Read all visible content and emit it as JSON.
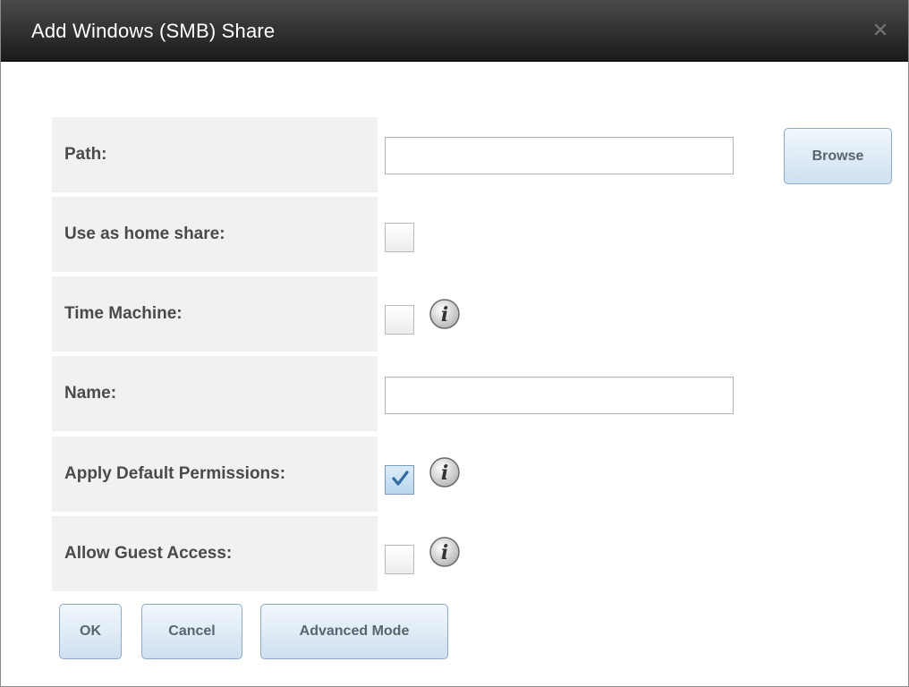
{
  "dialog": {
    "title": "Add Windows (SMB) Share",
    "close_icon": "close-icon"
  },
  "form": {
    "path": {
      "label": "Path:",
      "value": "",
      "placeholder": ""
    },
    "browse_button": "Browse",
    "home_share": {
      "label": "Use as home share:",
      "checked": false
    },
    "time_machine": {
      "label": "Time Machine:",
      "checked": false,
      "icon": "info-icon"
    },
    "name": {
      "label": "Name:",
      "value": "",
      "placeholder": ""
    },
    "default_permissions": {
      "label": "Apply Default Permissions:",
      "checked": true,
      "icon": "info-icon"
    },
    "guest_access": {
      "label": "Allow Guest Access:",
      "checked": false,
      "icon": "info-icon"
    }
  },
  "buttons": {
    "ok": "OK",
    "cancel": "Cancel",
    "advanced": "Advanced Mode"
  },
  "colors": {
    "titlebar": "#2b2b2b",
    "label_bg": "#f1f1f1",
    "button_border": "#8aaccf",
    "checkbox_checked": "#b8d6ee"
  }
}
